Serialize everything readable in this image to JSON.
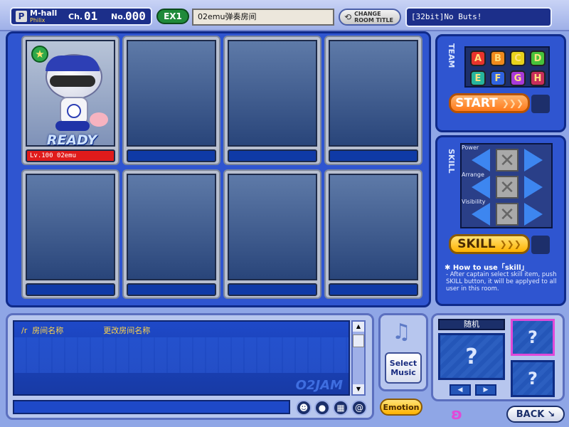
{
  "topbar": {
    "hall_badge": "P",
    "hall_name": "M-hall",
    "hall_sub": "Philix",
    "ch_label": "Ch.",
    "ch_value": "01",
    "no_label": "No.",
    "no_value": "000",
    "mode_label": "EX1",
    "room_title": "02emu弹奏房间",
    "change_btn_line1": "CHANGE",
    "change_btn_line2": "ROOM TITLE",
    "notice": "[32bit]No Buts!"
  },
  "slots": [
    {
      "name": "Lv.100 02emu",
      "status": "READY"
    },
    {
      "name": "",
      "status": ""
    },
    {
      "name": "",
      "status": ""
    },
    {
      "name": "",
      "status": ""
    },
    {
      "name": "",
      "status": ""
    },
    {
      "name": "",
      "status": ""
    },
    {
      "name": "",
      "status": ""
    },
    {
      "name": "",
      "status": ""
    }
  ],
  "team": {
    "label": "TEAM",
    "keys": [
      "A",
      "B",
      "C",
      "D",
      "E",
      "F",
      "G",
      "H"
    ],
    "start": "START"
  },
  "skill": {
    "label": "SKILL",
    "rows": [
      "Power",
      "Arrange",
      "Visibility"
    ],
    "button": "SKILL",
    "howto_title": "How to use「skill」",
    "howto_text": "- After captain select skill item, push SKILL button, it will be applyed to all user in this room."
  },
  "chat": {
    "line_cmd": "/r",
    "line_label": "房间名称",
    "line_msg": "更改房间名称",
    "watermark": "O2JAM"
  },
  "music": {
    "select_line1": "Select",
    "select_line2": "Music"
  },
  "bottom": {
    "emotion": "Emotion",
    "back": "BACK"
  },
  "random": {
    "label": "随机",
    "q": "?"
  }
}
